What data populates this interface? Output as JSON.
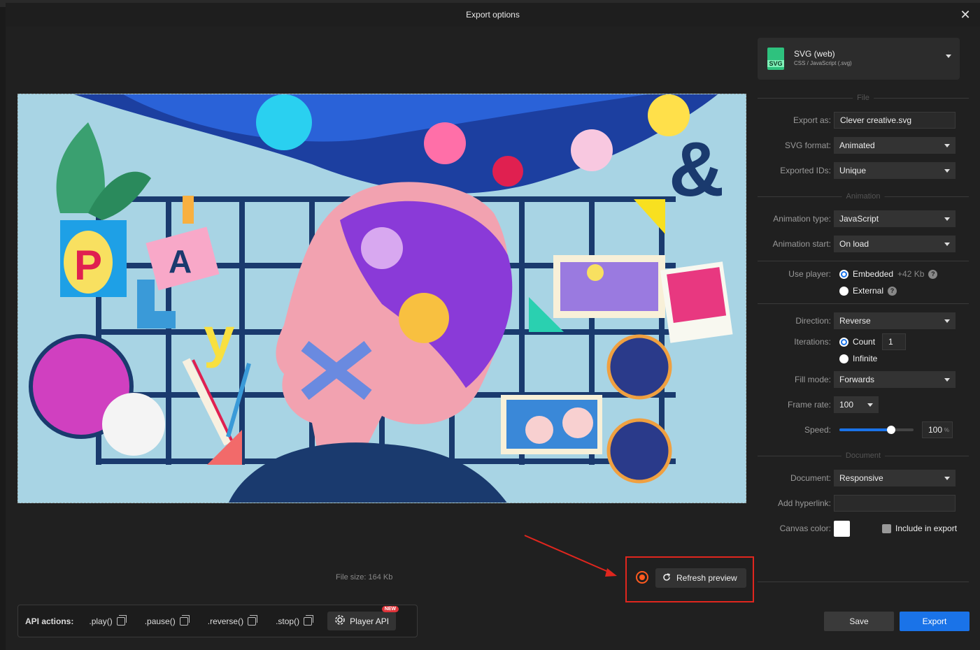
{
  "dialog": {
    "title": "Export options",
    "close_label": "✕"
  },
  "preview": {
    "file_size": "File size: 164 Kb",
    "refresh_label": "Refresh preview"
  },
  "api": {
    "label": "API actions:",
    "actions": [
      ".play()",
      ".pause()",
      ".reverse()",
      ".stop()"
    ],
    "player_api_label": "Player API",
    "new_badge": "NEW"
  },
  "format": {
    "name": "SVG (web)",
    "sub": "CSS / JavaScript (.svg)",
    "badge": "SVG"
  },
  "sections": {
    "file": "File",
    "animation": "Animation",
    "document": "Document"
  },
  "file": {
    "export_as_label": "Export as:",
    "export_as_value": "Clever creative.svg",
    "svg_format_label": "SVG format:",
    "svg_format_value": "Animated",
    "exported_ids_label": "Exported IDs:",
    "exported_ids_value": "Unique"
  },
  "animation": {
    "type_label": "Animation type:",
    "type_value": "JavaScript",
    "start_label": "Animation start:",
    "start_value": "On load",
    "use_player_label": "Use player:",
    "embedded_label": "Embedded",
    "embedded_size": "+42 Kb",
    "external_label": "External",
    "direction_label": "Direction:",
    "direction_value": "Reverse",
    "iterations_label": "Iterations:",
    "count_label": "Count",
    "count_value": "1",
    "infinite_label": "Infinite",
    "fill_mode_label": "Fill mode:",
    "fill_mode_value": "Forwards",
    "frame_rate_label": "Frame rate:",
    "frame_rate_value": "100",
    "speed_label": "Speed:",
    "speed_value": "100",
    "speed_unit": "%",
    "speed_level": 0.7
  },
  "document": {
    "document_label": "Document:",
    "document_value": "Responsive",
    "hyperlink_label": "Add hyperlink:",
    "hyperlink_value": "",
    "canvas_color_label": "Canvas color:",
    "canvas_color": "#ffffff",
    "include_label": "Include in export"
  },
  "buttons": {
    "save": "Save",
    "export": "Export"
  },
  "colors": {
    "accent": "#1a73e8",
    "annotation": "#e0261e",
    "record": "#ff5a1f"
  }
}
